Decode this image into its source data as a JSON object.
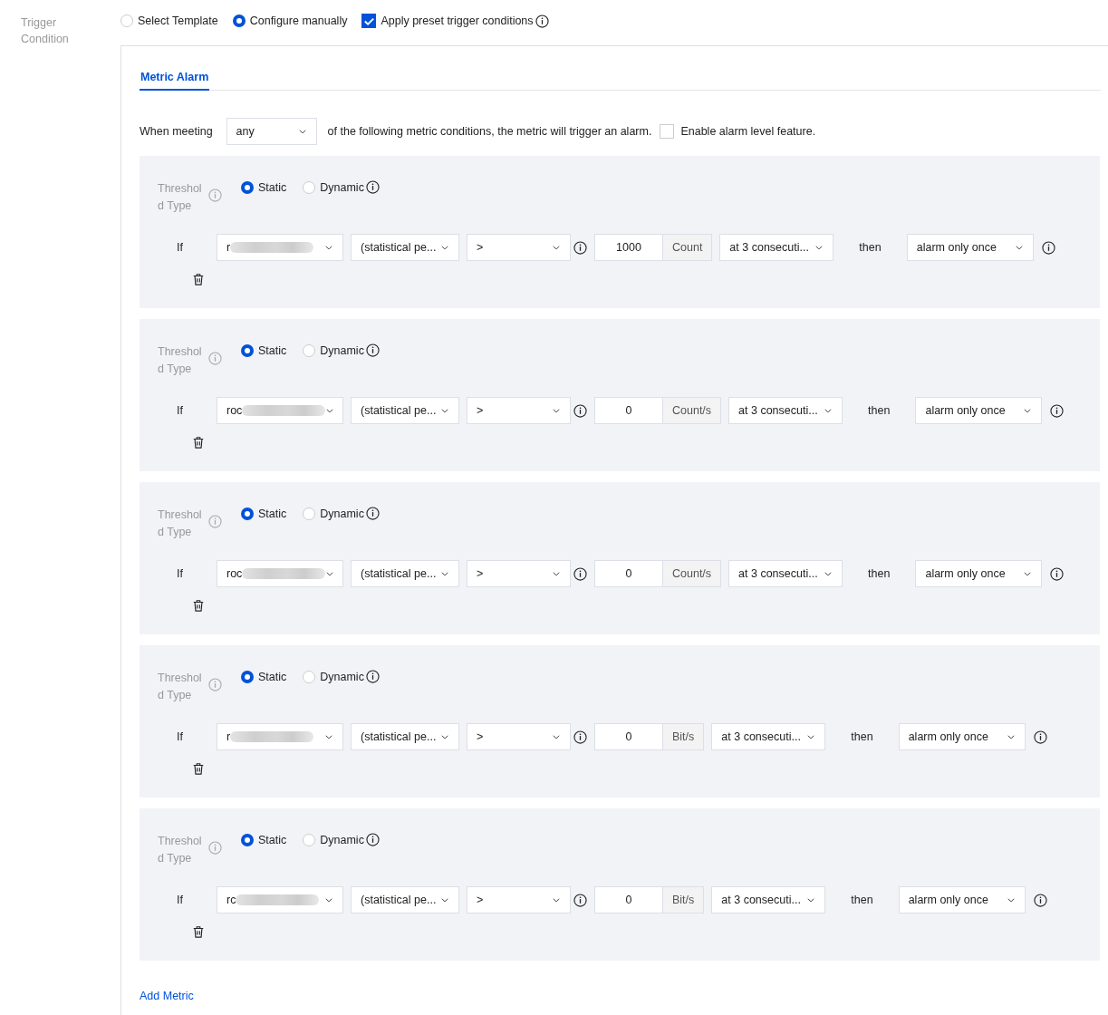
{
  "field_label": "Trigger Condition",
  "modes": [
    {
      "label": "Select Template",
      "selected": false
    },
    {
      "label": "Configure manually",
      "selected": true
    }
  ],
  "preset": {
    "label": "Apply preset trigger conditions",
    "checked": true
  },
  "tabs": [
    {
      "label": "Metric Alarm",
      "selected": true
    }
  ],
  "condition": {
    "prefix": "When meeting",
    "match": "any",
    "suffix": "of the following metric conditions, the metric will trigger an alarm.",
    "alarm_level": {
      "label": "Enable alarm level feature.",
      "checked": false
    }
  },
  "rules": [
    {
      "threshold_label": "Threshold Type",
      "threshold_types": [
        {
          "label": "Static",
          "selected": true
        },
        {
          "label": "Dynamic",
          "selected": false
        }
      ],
      "if_label": "If",
      "metric": "r",
      "statistic": "(statistical pe...",
      "operator": ">",
      "value": "1000",
      "unit": "Count",
      "period": "at 3 consecuti...",
      "then_label": "then",
      "frequency": "alarm only once"
    },
    {
      "threshold_label": "Threshold Type",
      "threshold_types": [
        {
          "label": "Static",
          "selected": true
        },
        {
          "label": "Dynamic",
          "selected": false
        }
      ],
      "if_label": "If",
      "metric": "roc",
      "statistic": "(statistical pe...",
      "operator": ">",
      "value": "0",
      "unit": "Count/s",
      "period": "at 3 consecuti...",
      "then_label": "then",
      "frequency": "alarm only once"
    },
    {
      "threshold_label": "Threshold Type",
      "threshold_types": [
        {
          "label": "Static",
          "selected": true
        },
        {
          "label": "Dynamic",
          "selected": false
        }
      ],
      "if_label": "If",
      "metric": "roc",
      "statistic": "(statistical pe...",
      "operator": ">",
      "value": "0",
      "unit": "Count/s",
      "period": "at 3 consecuti...",
      "then_label": "then",
      "frequency": "alarm only once"
    },
    {
      "threshold_label": "Threshold Type",
      "threshold_types": [
        {
          "label": "Static",
          "selected": true
        },
        {
          "label": "Dynamic",
          "selected": false
        }
      ],
      "if_label": "If",
      "metric": "r",
      "statistic": "(statistical pe...",
      "operator": ">",
      "value": "0",
      "unit": "Bit/s",
      "period": "at 3 consecuti...",
      "then_label": "then",
      "frequency": "alarm only once"
    },
    {
      "threshold_label": "Threshold Type",
      "threshold_types": [
        {
          "label": "Static",
          "selected": true
        },
        {
          "label": "Dynamic",
          "selected": false
        }
      ],
      "if_label": "If",
      "metric": "rc",
      "statistic": "(statistical pe...",
      "operator": ">",
      "value": "0",
      "unit": "Bit/s",
      "period": "at 3 consecuti...",
      "then_label": "then",
      "frequency": "alarm only once"
    }
  ],
  "add_metric": "Add Metric"
}
